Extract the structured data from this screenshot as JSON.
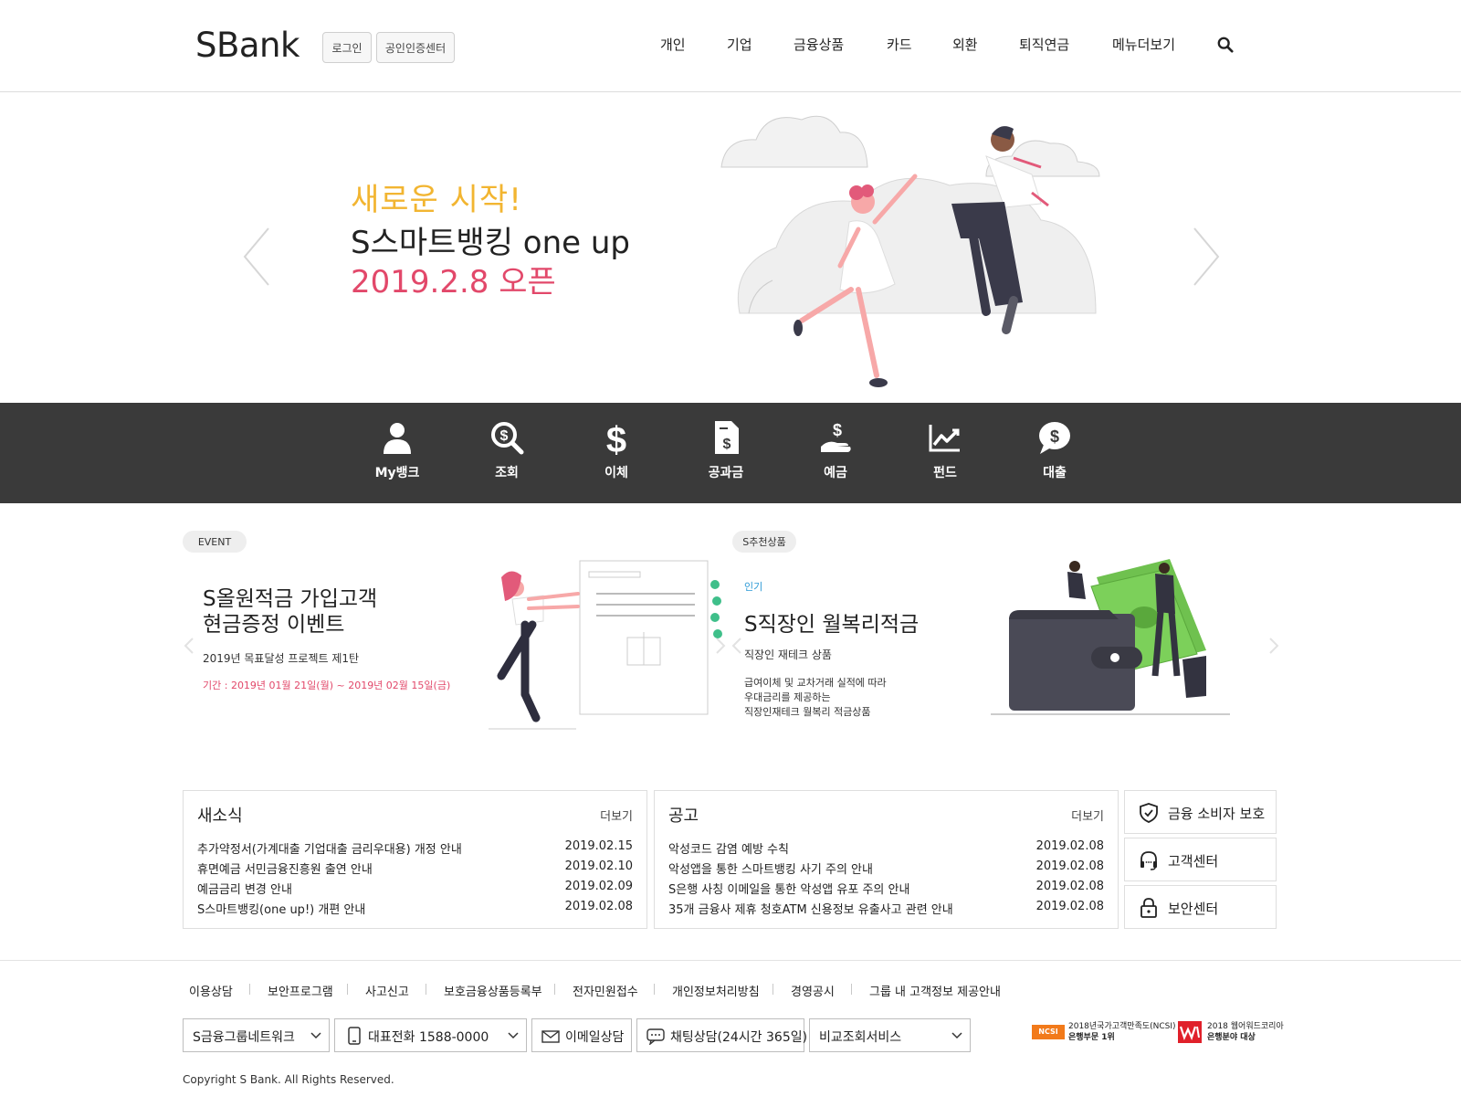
{
  "header": {
    "logo": "SBank",
    "login": "로그인",
    "cert_center": "공인인증센터",
    "nav": [
      "개인",
      "기업",
      "금융상품",
      "카드",
      "외환",
      "퇴직연금",
      "메뉴더보기"
    ]
  },
  "hero": {
    "line1": "새로운 시작!",
    "line2": "S스마트뱅킹 one up",
    "line3": "2019.2.8 오픈"
  },
  "quick_menu": [
    {
      "label": "My뱅크",
      "icon": "user-icon"
    },
    {
      "label": "조회",
      "icon": "search-money-icon"
    },
    {
      "label": "이체",
      "icon": "dollar-icon"
    },
    {
      "label": "공과금",
      "icon": "bill-icon"
    },
    {
      "label": "예금",
      "icon": "deposit-icon"
    },
    {
      "label": "펀드",
      "icon": "chart-icon"
    },
    {
      "label": "대출",
      "icon": "loan-bubble-icon"
    }
  ],
  "event": {
    "badge": "EVENT",
    "title_line1": "S올원적금 가입고객",
    "title_line2": "현금증정 이벤트",
    "subtitle": "2019년 목표달성 프로젝트 제1탄",
    "period": "기간 : 2019년 01월 21일(월) ~ 2019년 02월 15일(금)"
  },
  "recommend": {
    "badge": "S추천상품",
    "tag": "인기",
    "title": "S직장인 월복리적금",
    "subtitle": "직장인 재테크 상품",
    "desc_line1": "급여이체 및 교차거래 실적에 따라",
    "desc_line2": "우대금리를 제공하는",
    "desc_line3": "직장인재테크 월복리 적금상품"
  },
  "news": {
    "title": "새소식",
    "more": "더보기",
    "items": [
      {
        "title": "추가약정서(가계대출 기업대출 금리우대용) 개정 안내",
        "date": "2019.02.15"
      },
      {
        "title": "휴면예금 서민금융진흥원 출연 안내",
        "date": "2019.02.10"
      },
      {
        "title": "예금금리 변경 안내",
        "date": "2019.02.09"
      },
      {
        "title": "S스마트뱅킹(one up!) 개편 안내",
        "date": "2019.02.08"
      }
    ]
  },
  "notice": {
    "title": "공고",
    "more": "더보기",
    "items": [
      {
        "title": "악성코드 감염 예방 수칙",
        "date": "2019.02.08"
      },
      {
        "title": "악성앱을 통한 스마트뱅킹 사기 주의 안내",
        "date": "2019.02.08"
      },
      {
        "title": "S은행 사칭 이메일을 통한 악성앱 유포 주의 안내",
        "date": "2019.02.08"
      },
      {
        "title": "35개 금융사 제휴 청호ATM 신용정보 유출사고 관련 안내",
        "date": "2019.02.08"
      }
    ]
  },
  "side_links": [
    {
      "label": "금융 소비자 보호",
      "icon": "shield-check-icon"
    },
    {
      "label": "고객센터",
      "icon": "headset-icon"
    },
    {
      "label": "보안센터",
      "icon": "lock-icon"
    }
  ],
  "footer": {
    "links": [
      "이용상담",
      "보안프로그램",
      "사고신고",
      "보호금융상품등록부",
      "전자민원접수",
      "개인정보처리방침",
      "경영공시",
      "그룹 내 고객정보 제공안내"
    ],
    "network_select": "S금융그룹네트워크",
    "phone": "대표전화 1588-0000",
    "email": "이메일상담",
    "chat": "채팅상담(24시간 365일)",
    "compare_select": "비교조회서비스",
    "award1_badge": "NCSI",
    "award1_line1": "2018년국가고객만족도(NCSI)",
    "award1_line2": "은행부문 1위",
    "award2_line1": "2018 웹어워드코리아",
    "award2_line2": "은행분야 대상",
    "copyright": "Copyright S Bank. All Rights Reserved."
  },
  "colors": {
    "accent_yellow": "#f2b531",
    "accent_pink": "#e2486a",
    "quick_bg": "#3a3a3a",
    "tag_blue": "#2d9ad6"
  }
}
